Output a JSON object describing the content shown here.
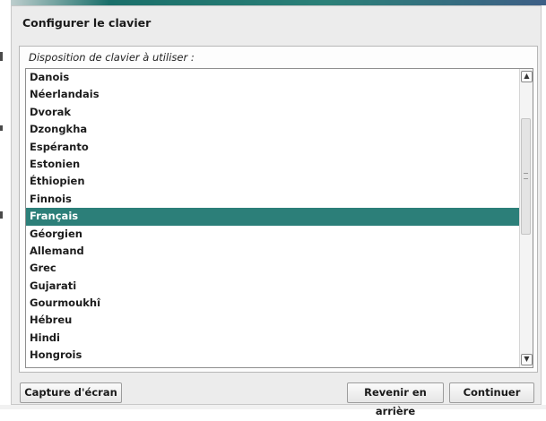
{
  "window": {
    "title": "Configurer le clavier"
  },
  "panel": {
    "label": "Disposition de clavier à utiliser :"
  },
  "layouts": [
    "Danois",
    "Néerlandais",
    "Dvorak",
    "Dzongkha",
    "Espéranto",
    "Estonien",
    "Éthiopien",
    "Finnois",
    "Français",
    "Géorgien",
    "Allemand",
    "Grec",
    "Gujarati",
    "Gourmoukhî",
    "Hébreu",
    "Hindi",
    "Hongrois"
  ],
  "selected": "Français",
  "scrollbar": {
    "up_glyph": "▲",
    "down_glyph": "▼"
  },
  "buttons": {
    "capture": "Capture d'écran",
    "back": "Revenir en arrière",
    "continue": "Continuer"
  },
  "colors": {
    "selection": "#2c7f79",
    "window_bg": "#ececec"
  }
}
